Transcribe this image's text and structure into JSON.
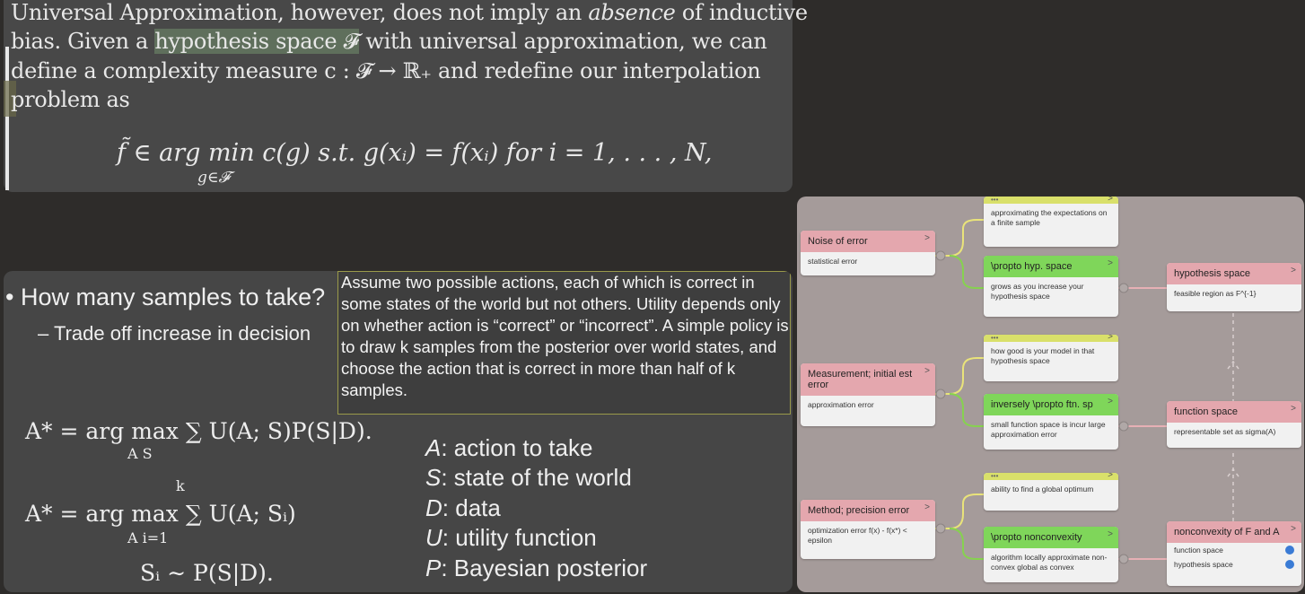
{
  "paper": {
    "l1a": "Universal Approximation, however, does not imply an ",
    "l1em": "absence",
    "l1b": " of inductive",
    "l2a": "bias.  Given a ",
    "l2hl": "hypothesis space 𝓕",
    "l2b": " with universal approximation, we can",
    "l3": "define a complexity measure c : 𝓕 → ℝ₊ and redefine our interpolation",
    "l4": "problem as",
    "eq": "f̃ ∈ arg min c(g)    s.t.    g(xᵢ) = f(xᵢ)    for  i = 1, . . . , N,",
    "eq_sub": "g∈𝓕"
  },
  "slide": {
    "bullet": "How many samples to take?",
    "dash": "– Trade off increase in decision",
    "note": "Assume two possible actions, each of which is correct in some states of the world but not others. Utility depends only on whether action is “correct” or “incorrect”.  A simple policy is to draw k samples from the posterior over world states, and choose the action that is correct in more than half of k samples.",
    "eq1": "A* = arg max ∑ U(A; S)P(S|D).",
    "eq1_sub": "A          S",
    "eq2": "A* = arg max ∑ U(A; Sᵢ)",
    "eq2_sub": "A        i=1",
    "eq2_sup": "k",
    "eq3": "Sᵢ ∼ P(S|D).",
    "legend": [
      {
        "sym": "A",
        "text": ": action to take"
      },
      {
        "sym": "S",
        "text": ": state of the world"
      },
      {
        "sym": "D",
        "text": ": data"
      },
      {
        "sym": "U",
        "text": ": utility function"
      },
      {
        "sym": "P",
        "text": ": Bayesian posterior"
      }
    ]
  },
  "mindmap": {
    "ellipsis": "•••",
    "chevron": ">",
    "n_noise": {
      "title": "Noise of error",
      "body": "statistical error"
    },
    "n_approx_exp": {
      "body": "approximating the  expectations on a finite sample"
    },
    "n_propto_hyp": {
      "title": "\\propto hyp. space",
      "body": "grows as you increase your hypothesis  space"
    },
    "n_hyp_space": {
      "title": "hypothesis space",
      "body": "feasible region as F^{-1}"
    },
    "n_measure": {
      "title": "Measurement; initial est error",
      "body": "approximation error"
    },
    "n_howgood": {
      "body": "how good is  your model in that hypothesis space"
    },
    "n_inv_propto": {
      "title": "inversely \\propto ftn. sp",
      "body": "small function space is incur large approximation error"
    },
    "n_func_space": {
      "title": "function space",
      "body": "representable set as sigma(A)"
    },
    "n_method": {
      "title": "Method; precision error",
      "body": "optimization error f(x) - f(x*) < epsilon"
    },
    "n_ability": {
      "body": "ability  to find a global optimum"
    },
    "n_propto_nonc": {
      "title": "\\propto nonconvexity",
      "body": "algorithm locally approximate non-convex global as convex"
    },
    "n_nonconvex": {
      "title": "nonconvexity of F and A",
      "rows": [
        "function space",
        "hypothesis space"
      ]
    }
  }
}
